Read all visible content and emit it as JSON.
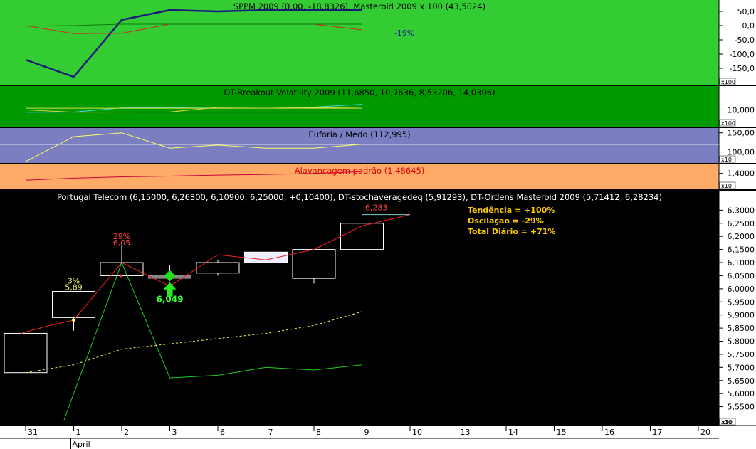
{
  "colors": {
    "panel1_bg": "#33cc33",
    "panel2_bg": "#009900",
    "panel3_bg": "#7b7ec0",
    "panel4_bg": "#ffaa66",
    "main_bg": "#000000",
    "axis_bg": "#ffffff"
  },
  "chart_data": [
    {
      "type": "line",
      "title": "SPPM 2009 (0,00, -18,8326), Masteroid 2009 x 100 (43,5024)",
      "annotation": "-19%",
      "x": [
        0,
        1,
        2,
        3,
        4,
        5,
        6,
        7
      ],
      "series": [
        {
          "color": "#1a1a7a",
          "values": [
            -120,
            -180,
            20,
            55,
            50,
            55,
            55,
            55
          ]
        },
        {
          "color": "#dd2222",
          "values": [
            0,
            -28,
            -27,
            5,
            5,
            5,
            5,
            -15
          ]
        },
        {
          "color": "#117711",
          "values": [
            -2,
            0,
            5,
            5,
            5,
            5,
            5,
            5
          ]
        }
      ],
      "ylim": [
        -190,
        75
      ],
      "yticks": [
        "50,0",
        "0,0",
        "-50,0",
        "-100,0",
        "-150,0"
      ],
      "ytick_values": [
        50,
        0,
        -50,
        -100,
        -150
      ],
      "scale": "x100"
    },
    {
      "type": "line",
      "title": "DT-Breakout Volatility 2009 (11,6850, 10,7636, 8,53206, 14,0306)",
      "x": [
        0,
        1,
        2,
        3,
        4,
        5,
        6,
        7
      ],
      "series": [
        {
          "color": "#44dddd",
          "values": [
            8.2,
            8.4,
            11.5,
            11.5,
            12,
            12,
            12,
            14
          ]
        },
        {
          "color": "#dddd44",
          "values": [
            10,
            8.3,
            8.4,
            8.5,
            11.8,
            12,
            11.5,
            12
          ]
        },
        {
          "color": "#dddd44",
          "values": [
            11.2,
            11.2,
            11.2,
            11.2,
            11.2,
            11.2,
            11.2,
            11.2
          ]
        },
        {
          "color": "#111111",
          "values": [
            8.4,
            8.4,
            8.4,
            8.4,
            8.4,
            8.4,
            8.4,
            8.4
          ]
        }
      ],
      "ylim": [
        0,
        23
      ],
      "yticks": [
        "10,000"
      ],
      "ytick_values": [
        10
      ],
      "scale": "x100"
    },
    {
      "type": "line",
      "title": "Euforia / Medo (112,995)",
      "x": [
        0,
        1,
        2,
        3,
        4,
        5,
        6,
        7
      ],
      "series": [
        {
          "color": "#ffff66",
          "values": [
            75,
            140,
            150,
            110,
            118,
            110,
            110,
            120
          ]
        }
      ],
      "hline": {
        "value": 120,
        "color": "#ffffff"
      },
      "ylim": [
        75,
        155
      ],
      "yticks": [
        "150,00",
        "100,00"
      ],
      "ytick_values": [
        150,
        100
      ],
      "scale": "x10"
    },
    {
      "type": "line",
      "title": "Alavancagem padrão (1,48645)",
      "x": [
        0,
        1,
        2,
        3,
        4,
        5,
        6,
        7
      ],
      "series": [
        {
          "color": "#cc0044",
          "values": [
            1.2,
            1.26,
            1.3,
            1.32,
            1.35,
            1.37,
            1.4,
            1.45
          ]
        }
      ],
      "ylim": [
        1.0,
        1.6
      ],
      "yticks": [
        "1,4000"
      ],
      "ytick_values": [
        1.4
      ],
      "scale": "x10"
    },
    {
      "type": "candlestick",
      "title": "Portugal Telecom (6,15000, 6,26300, 6,10900, 6,25000, +0,10400), DT-stochaveragedeq (5,91293), DT-Ordens Masteroid 2009 (5,71412, 6,28234)",
      "x_labels": [
        "31",
        "1",
        "2",
        "3",
        "6",
        "7",
        "8",
        "9",
        "10",
        "13",
        "14",
        "15",
        "16",
        "17",
        "20"
      ],
      "month_label": "April",
      "ylim": [
        5.5,
        6.32
      ],
      "yticks": [
        "6,3000",
        "6,2500",
        "6,2000",
        "6,1500",
        "6,1000",
        "6,0500",
        "6,0000",
        "5,9500",
        "5,9000",
        "5,8500",
        "5,8000",
        "5,7500",
        "5,7000",
        "5,6500",
        "5,6000",
        "5,5500"
      ],
      "ytick_values": [
        6.3,
        6.25,
        6.2,
        6.15,
        6.1,
        6.05,
        6.0,
        5.95,
        5.9,
        5.85,
        5.8,
        5.75,
        5.7,
        5.65,
        5.6,
        5.55
      ],
      "scale": "x10",
      "candles": [
        {
          "x": 0,
          "open": 5.68,
          "close": 5.83,
          "high": 5.83,
          "low": 5.68,
          "fill": "none"
        },
        {
          "x": 1,
          "open": 5.89,
          "close": 5.99,
          "high": 5.99,
          "low": 5.84,
          "fill": "none"
        },
        {
          "x": 2,
          "open": 6.05,
          "close": 6.1,
          "high": 6.17,
          "low": 6.05,
          "fill": "none"
        },
        {
          "x": 3,
          "open": 6.04,
          "close": 6.05,
          "high": 6.09,
          "low": 6.03,
          "fill": "#888888"
        },
        {
          "x": 4,
          "open": 6.06,
          "close": 6.1,
          "high": 6.11,
          "low": 6.05,
          "fill": "none"
        },
        {
          "x": 5,
          "open": 6.1,
          "close": 6.14,
          "high": 6.18,
          "low": 6.07,
          "fill": "#eeeeff"
        },
        {
          "x": 6,
          "open": 6.04,
          "close": 6.15,
          "high": 6.15,
          "low": 6.02,
          "fill": "none"
        },
        {
          "x": 7,
          "open": 6.15,
          "close": 6.25,
          "high": 6.26,
          "low": 6.11,
          "fill": "none"
        }
      ],
      "series": [
        {
          "color": "#ee2222",
          "x": [
            -0.1,
            0.5,
            1,
            2,
            3,
            4,
            5,
            6,
            7,
            8
          ],
          "values": [
            5.83,
            5.86,
            5.88,
            6.1,
            6.01,
            6.13,
            6.11,
            6.15,
            6.24,
            6.283
          ]
        },
        {
          "color": "#22cc22",
          "x": [
            0.8,
            2,
            3,
            4,
            5,
            6,
            7
          ],
          "values": [
            5.5,
            6.1,
            5.66,
            5.67,
            5.7,
            5.69,
            5.71
          ]
        },
        {
          "color": "#eeee66",
          "dashed": true,
          "x": [
            0,
            1,
            2,
            3,
            4,
            5,
            6,
            7
          ],
          "values": [
            5.68,
            5.71,
            5.77,
            5.79,
            5.81,
            5.83,
            5.86,
            5.913
          ]
        },
        {
          "color": "#77cccc",
          "x": [
            7,
            8
          ],
          "values": [
            6.283,
            6.283
          ]
        }
      ],
      "annotations": [
        {
          "text": "29%",
          "x": 2,
          "value": 6.19,
          "color": "#ff4444"
        },
        {
          "text": "6,05",
          "x": 2,
          "value": 6.165,
          "color": "#ff4444"
        },
        {
          "text": "3%",
          "x": 1,
          "value": 6.02,
          "color": "#ffff66"
        },
        {
          "text": "5,89",
          "x": 1,
          "value": 5.995,
          "color": "#ffff66"
        },
        {
          "text": "6,283",
          "x": 7.3,
          "value": 6.3,
          "color": "#ff4444"
        },
        {
          "text": "T",
          "x": 3,
          "value": 5.98,
          "color": "#33ff33"
        },
        {
          "text": "6,049",
          "x": 3,
          "value": 5.95,
          "color": "#33ff33"
        }
      ],
      "legend_lines": [
        "Tendência = +100%",
        "Oscilação = -29%",
        "Total Diário = +71%"
      ],
      "legend_color": "#ffcc00"
    }
  ]
}
